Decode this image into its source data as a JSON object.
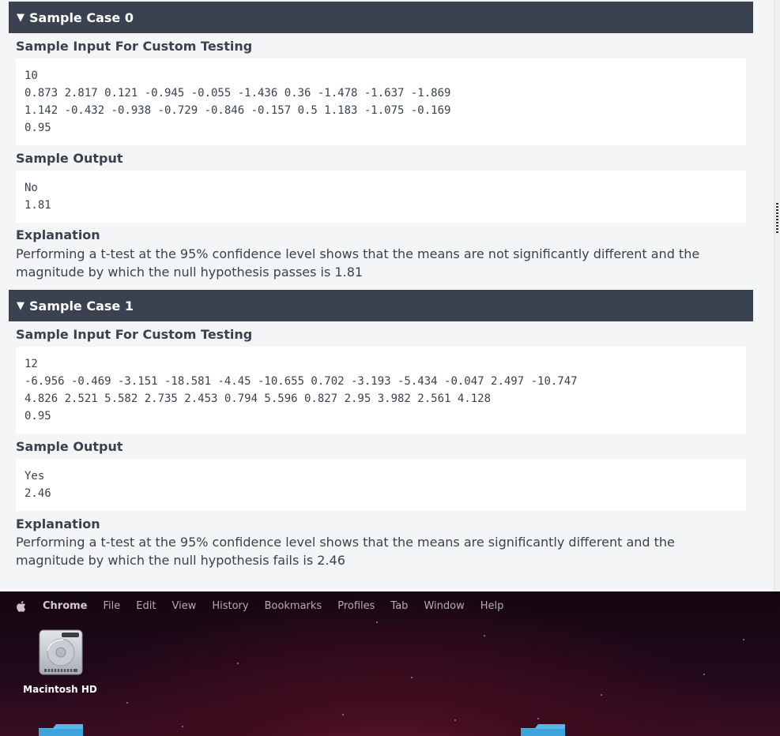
{
  "cases": [
    {
      "title": "Sample Case 0",
      "input_label": "Sample Input For Custom Testing",
      "input_lines": [
        "10",
        "0.873 2.817 0.121 -0.945 -0.055 -1.436 0.36 -1.478 -1.637 -1.869",
        "1.142 -0.432 -0.938 -0.729 -0.846 -0.157 0.5 1.183 -1.075 -0.169",
        "0.95"
      ],
      "output_label": "Sample Output",
      "output_lines": [
        "No",
        "1.81"
      ],
      "explanation_label": "Explanation",
      "explanation_text": "Performing a t-test at the 95% confidence level shows that the means are not significantly different and the magnitude by which the null hypothesis passes is 1.81"
    },
    {
      "title": "Sample Case 1",
      "input_label": "Sample Input For Custom Testing",
      "input_lines": [
        "12",
        "-6.956 -0.469 -3.151 -18.581 -4.45 -10.655 0.702 -3.193 -5.434 -0.047 2.497 -10.747",
        "4.826 2.521 5.582 2.735 2.453 0.794 5.596 0.827 2.95 3.982 2.561 4.128",
        "0.95"
      ],
      "output_label": "Sample Output",
      "output_lines": [
        "Yes",
        "2.46"
      ],
      "explanation_label": "Explanation",
      "explanation_text": "Performing a t-test at the 95% confidence level shows that the means are significantly different and the magnitude by which the null hypothesis fails is 2.46"
    }
  ],
  "menubar": {
    "app": "Chrome",
    "items": [
      "File",
      "Edit",
      "View",
      "History",
      "Bookmarks",
      "Profiles",
      "Tab",
      "Window",
      "Help"
    ]
  },
  "desktop": {
    "disk_label": "Macintosh HD"
  },
  "icons": {
    "collapse": "triangle-down-icon",
    "apple": "apple-logo-icon",
    "disk": "hard-drive-icon",
    "folder": "folder-icon"
  },
  "colors": {
    "header_bg": "#39424e",
    "page_bg": "#f3f5f7",
    "text": "#39424e"
  }
}
